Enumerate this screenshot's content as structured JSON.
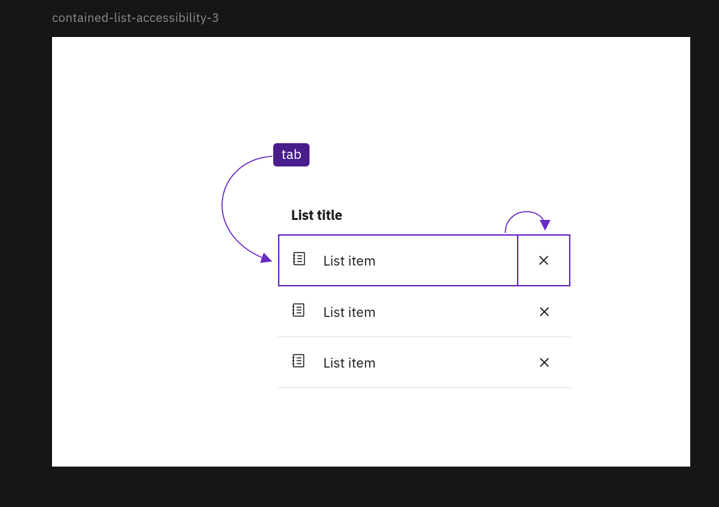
{
  "caption": "contained-list-accessibility-3",
  "badge": "tab",
  "list": {
    "title": "List title",
    "items": [
      {
        "label": "List item",
        "focused": true
      },
      {
        "label": "List item",
        "focused": false
      },
      {
        "label": "List item",
        "focused": false
      }
    ]
  },
  "colors": {
    "accent": "#491d8b",
    "focus": "#6929c4"
  }
}
